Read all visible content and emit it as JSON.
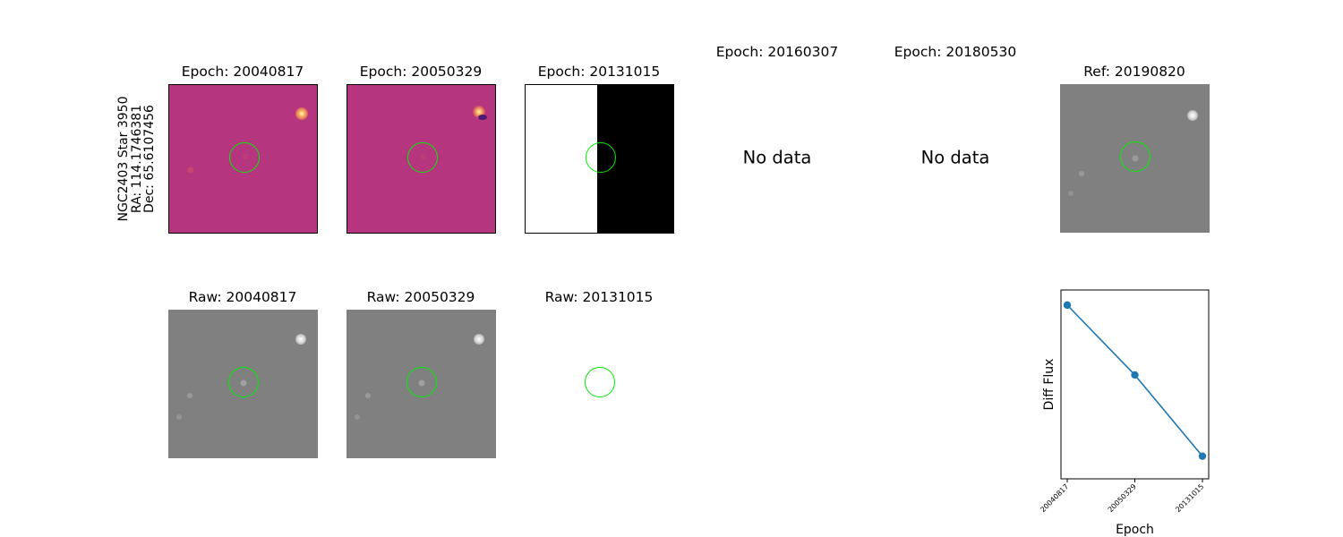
{
  "row_label": {
    "line1": "NGC2403 Star 3950",
    "line2": "RA: 114.1746381",
    "line3": "Dec: 65.6107456"
  },
  "top_row": [
    {
      "title": "Epoch: 20040817",
      "kind": "difference-image"
    },
    {
      "title": "Epoch: 20050329",
      "kind": "difference-image"
    },
    {
      "title": "Epoch: 20131015",
      "kind": "difference-image-saturated"
    },
    {
      "title": "Epoch: 20160307",
      "kind": "empty",
      "message": "No data"
    },
    {
      "title": "Epoch: 20180530",
      "kind": "empty",
      "message": "No data"
    },
    {
      "title": "Ref: 20190820",
      "kind": "reference-image"
    }
  ],
  "bottom_row": [
    {
      "title": "Raw: 20040817",
      "kind": "raw-image"
    },
    {
      "title": "Raw: 20050329",
      "kind": "raw-image"
    },
    {
      "title": "Raw: 20131015",
      "kind": "raw-image-blank"
    }
  ],
  "colors": {
    "aperture": "#00ee00",
    "diff_background": "#b5367e",
    "raw_background": "#808080",
    "series": "#1f77b4"
  },
  "chart_data": {
    "type": "line",
    "title": "",
    "xlabel": "Epoch",
    "ylabel": "Diff Flux",
    "categories": [
      "20040817",
      "20050329",
      "20131015"
    ],
    "series": [
      {
        "values": [
          0.92,
          0.55,
          0.12
        ]
      }
    ],
    "ylim": [
      0,
      1
    ],
    "y_tick_labels_shown": false,
    "grid": false,
    "legend": "none"
  }
}
